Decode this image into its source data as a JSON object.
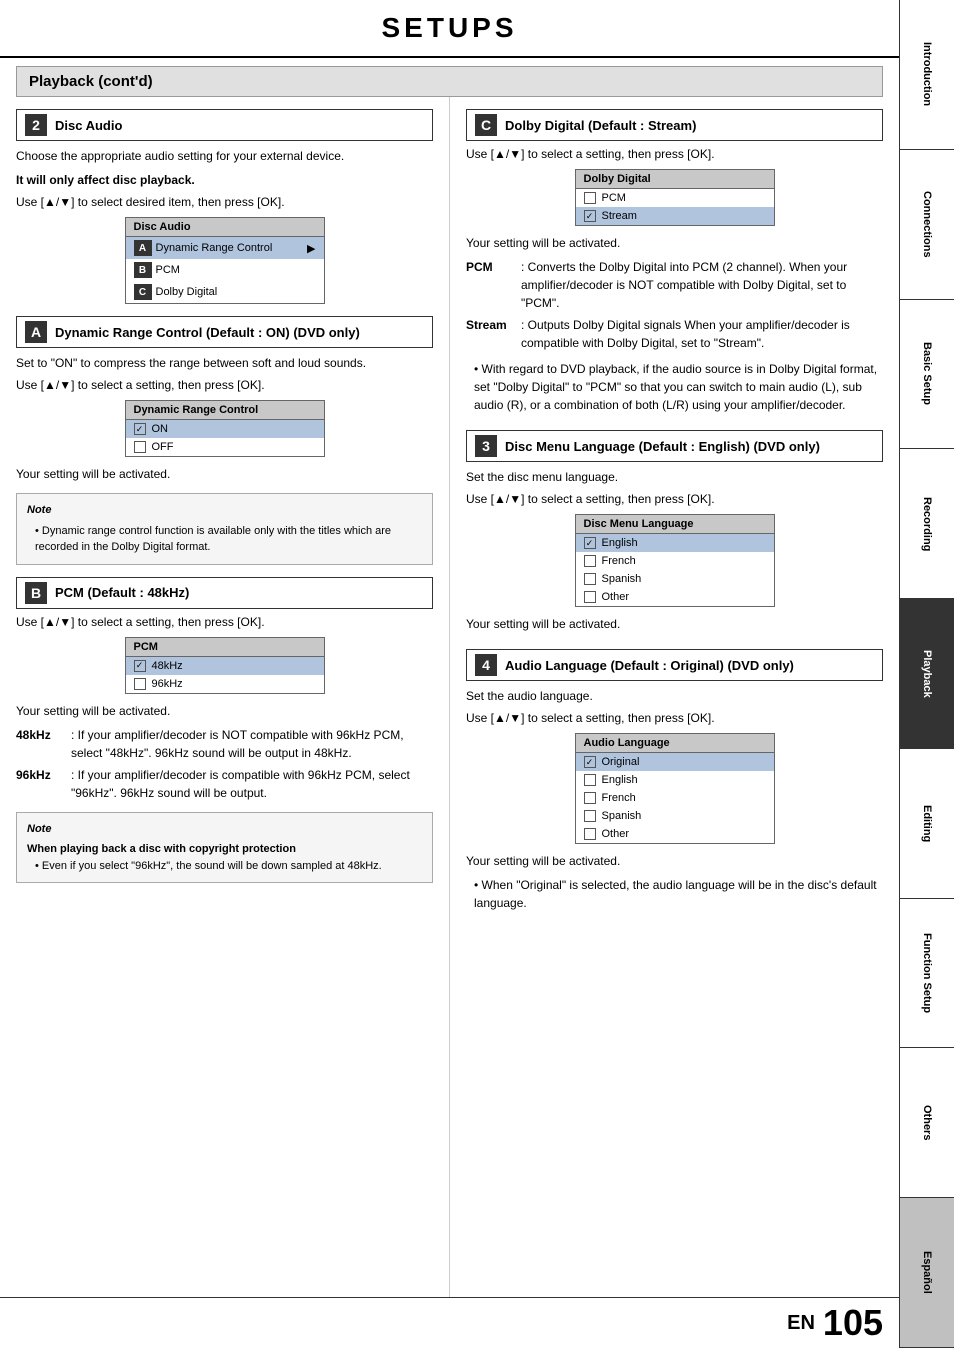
{
  "page": {
    "title": "SETUPS",
    "section_header": "Playback (cont'd)",
    "page_num": "105",
    "en_label": "EN"
  },
  "sidebar": {
    "items": [
      {
        "label": "Introduction"
      },
      {
        "label": "Connections"
      },
      {
        "label": "Basic Setup"
      },
      {
        "label": "Recording"
      },
      {
        "label": "Playback"
      },
      {
        "label": "Editing"
      },
      {
        "label": "Function Setup"
      },
      {
        "label": "Others"
      },
      {
        "label": "Español"
      }
    ]
  },
  "left_col": {
    "section2_label": "2",
    "section2_title": "Disc Audio",
    "section2_intro1": "Choose the appropriate audio setting for your external device.",
    "section2_intro2": "It will only affect disc playback.",
    "section2_instruction": "Use [▲/▼] to select desired item, then press [OK].",
    "disc_audio_menu_title": "Disc Audio",
    "disc_audio_items": [
      {
        "label": "A",
        "text": "Dynamic Range Control",
        "has_arrow": true,
        "highlighted": true
      },
      {
        "label": "B",
        "text": "PCM",
        "has_arrow": false,
        "highlighted": false
      },
      {
        "label": "C",
        "text": "Dolby Digital",
        "has_arrow": false,
        "highlighted": false
      }
    ],
    "sectionA_letter": "A",
    "sectionA_title": "Dynamic Range Control (Default : ON)   (DVD only)",
    "sectionA_intro": "Set to \"ON\" to compress the range between soft and loud sounds.",
    "sectionA_instruction": "Use [▲/▼] to select a setting, then press [OK].",
    "drc_menu_title": "Dynamic Range Control",
    "drc_items": [
      {
        "text": "ON",
        "checked": true,
        "highlighted": true
      },
      {
        "text": "OFF",
        "checked": false,
        "highlighted": false
      }
    ],
    "sectionA_activated": "Your setting will be activated.",
    "sectionA_note_title": "Note",
    "sectionA_note_text": "• Dynamic range control function is available only with the titles which are recorded in the Dolby Digital format.",
    "sectionB_letter": "B",
    "sectionB_title": "PCM (Default : 48kHz)",
    "sectionB_instruction": "Use [▲/▼] to select a setting, then press [OK].",
    "pcm_menu_title": "PCM",
    "pcm_items": [
      {
        "text": "48kHz",
        "checked": true,
        "highlighted": true
      },
      {
        "text": "96kHz",
        "checked": false,
        "highlighted": false
      }
    ],
    "sectionB_activated": "Your setting will be activated.",
    "desc_48khz_label": "48kHz",
    "desc_48khz_text": ": If your amplifier/decoder is NOT compatible with 96kHz PCM, select \"48kHz\". 96kHz sound will be output in 48kHz.",
    "desc_96khz_label": "96kHz",
    "desc_96khz_text": ": If your amplifier/decoder is compatible with 96kHz PCM, select \"96kHz\". 96kHz sound will be output.",
    "note2_title": "Note",
    "note2_bold": "When playing back a disc with copyright protection",
    "note2_text": "• Even if you select \"96kHz\", the sound will be down sampled at 48kHz."
  },
  "right_col": {
    "sectionC_letter": "C",
    "sectionC_title": "Dolby Digital (Default : Stream)",
    "sectionC_instruction": "Use [▲/▼] to select a setting, then press [OK].",
    "dolby_menu_title": "Dolby Digital",
    "dolby_items": [
      {
        "text": "PCM",
        "checked": false,
        "highlighted": false
      },
      {
        "text": "Stream",
        "checked": true,
        "highlighted": true
      }
    ],
    "sectionC_activated": "Your setting will be activated.",
    "desc_pcm_label": "PCM",
    "desc_pcm_text": ": Converts the Dolby Digital into PCM (2 channel). When your amplifier/decoder is NOT compatible with Dolby Digital, set to \"PCM\".",
    "desc_stream_label": "Stream",
    "desc_stream_text": ": Outputs Dolby Digital signals When your amplifier/decoder is compatible with Dolby Digital, set to \"Stream\".",
    "sectionC_note": "• With regard to DVD playback, if the audio source is in Dolby Digital format, set \"Dolby Digital\" to \"PCM\" so that you can switch to main audio (L), sub audio (R), or a combination of both (L/R) using your amplifier/decoder.",
    "section3_num": "3",
    "section3_title": "Disc Menu Language (Default : English) (DVD only)",
    "section3_intro": "Set the disc menu language.",
    "section3_instruction": "Use [▲/▼] to select a setting, then press [OK].",
    "disc_menu_title": "Disc Menu Language",
    "disc_menu_items": [
      {
        "text": "English",
        "checked": true,
        "highlighted": true
      },
      {
        "text": "French",
        "checked": false,
        "highlighted": false
      },
      {
        "text": "Spanish",
        "checked": false,
        "highlighted": false
      },
      {
        "text": "Other",
        "checked": false,
        "highlighted": false
      }
    ],
    "section3_activated": "Your setting will be activated.",
    "section4_num": "4",
    "section4_title": "Audio Language (Default : Original)  (DVD only)",
    "section4_intro": "Set the audio language.",
    "section4_instruction": "Use [▲/▼] to select a setting, then press [OK].",
    "audio_lang_title": "Audio Language",
    "audio_lang_items": [
      {
        "text": "Original",
        "checked": true,
        "highlighted": true
      },
      {
        "text": "English",
        "checked": false,
        "highlighted": false
      },
      {
        "text": "French",
        "checked": false,
        "highlighted": false
      },
      {
        "text": "Spanish",
        "checked": false,
        "highlighted": false
      },
      {
        "text": "Other",
        "checked": false,
        "highlighted": false
      }
    ],
    "section4_activated": "Your setting will be activated.",
    "section4_note": "• When \"Original\" is selected, the audio language will be in the disc's default language."
  }
}
